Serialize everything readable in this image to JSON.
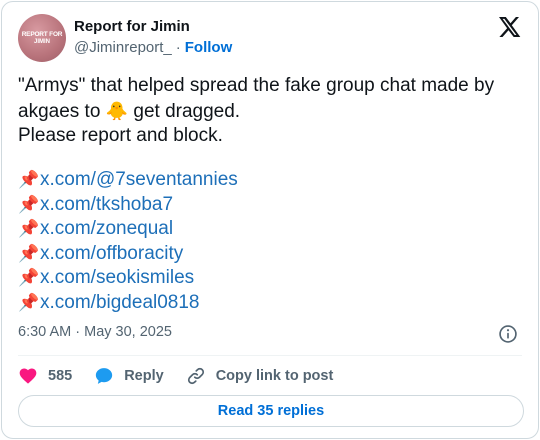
{
  "author": {
    "name": "Report for Jimin",
    "handle": "@Jiminreport_",
    "separator": "·",
    "follow_label": "Follow",
    "avatar_text_line1": "REPORT FOR",
    "avatar_text_line2": "JIMIN"
  },
  "tweet": {
    "line1": "\"Armys\" that helped spread the fake group chat made by",
    "line2_before": "akgaes to ",
    "line2_emoji": "🐥",
    "line2_after": " get dragged.",
    "line3": "Please report and block.",
    "pin_emoji": "📌",
    "links": [
      "x.com/@7seventannies",
      "x.com/tkshoba7",
      "x.com/zonequal",
      "x.com/offboracity",
      "x.com/seokismiles",
      "x.com/bigdeal0818"
    ]
  },
  "meta": {
    "time": "6:30 AM",
    "separator": "·",
    "date": "May 30, 2025"
  },
  "actions": {
    "like_count": "585",
    "reply_label": "Reply",
    "copy_label": "Copy link to post"
  },
  "read_replies_label": "Read 35 replies",
  "colors": {
    "link": "#1d6fb8",
    "follow": "#006fd6",
    "like_heart": "#f91880",
    "reply_bubble": "#1d9bf0",
    "muted": "#536471"
  }
}
